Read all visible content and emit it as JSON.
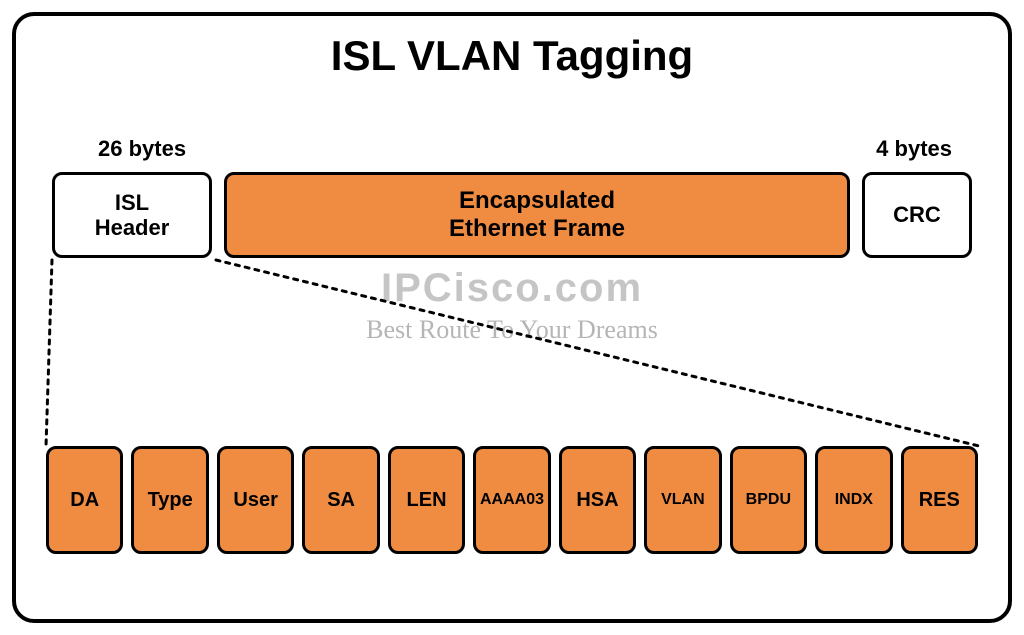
{
  "title": "ISL VLAN Tagging",
  "sizes": {
    "left": "26 bytes",
    "right": "4 bytes"
  },
  "top_blocks": {
    "isl_header": "ISL\nHeader",
    "encap": "Encapsulated\nEthernet Frame",
    "crc": "CRC"
  },
  "watermark": {
    "main": "IPCisco.com",
    "sub": "Best Route To Your Dreams"
  },
  "fields": [
    "DA",
    "Type",
    "User",
    "SA",
    "LEN",
    "AAAA03",
    "HSA",
    "VLAN",
    "BPDU",
    "INDX",
    "RES"
  ],
  "colors": {
    "orange": "#f08c42"
  }
}
